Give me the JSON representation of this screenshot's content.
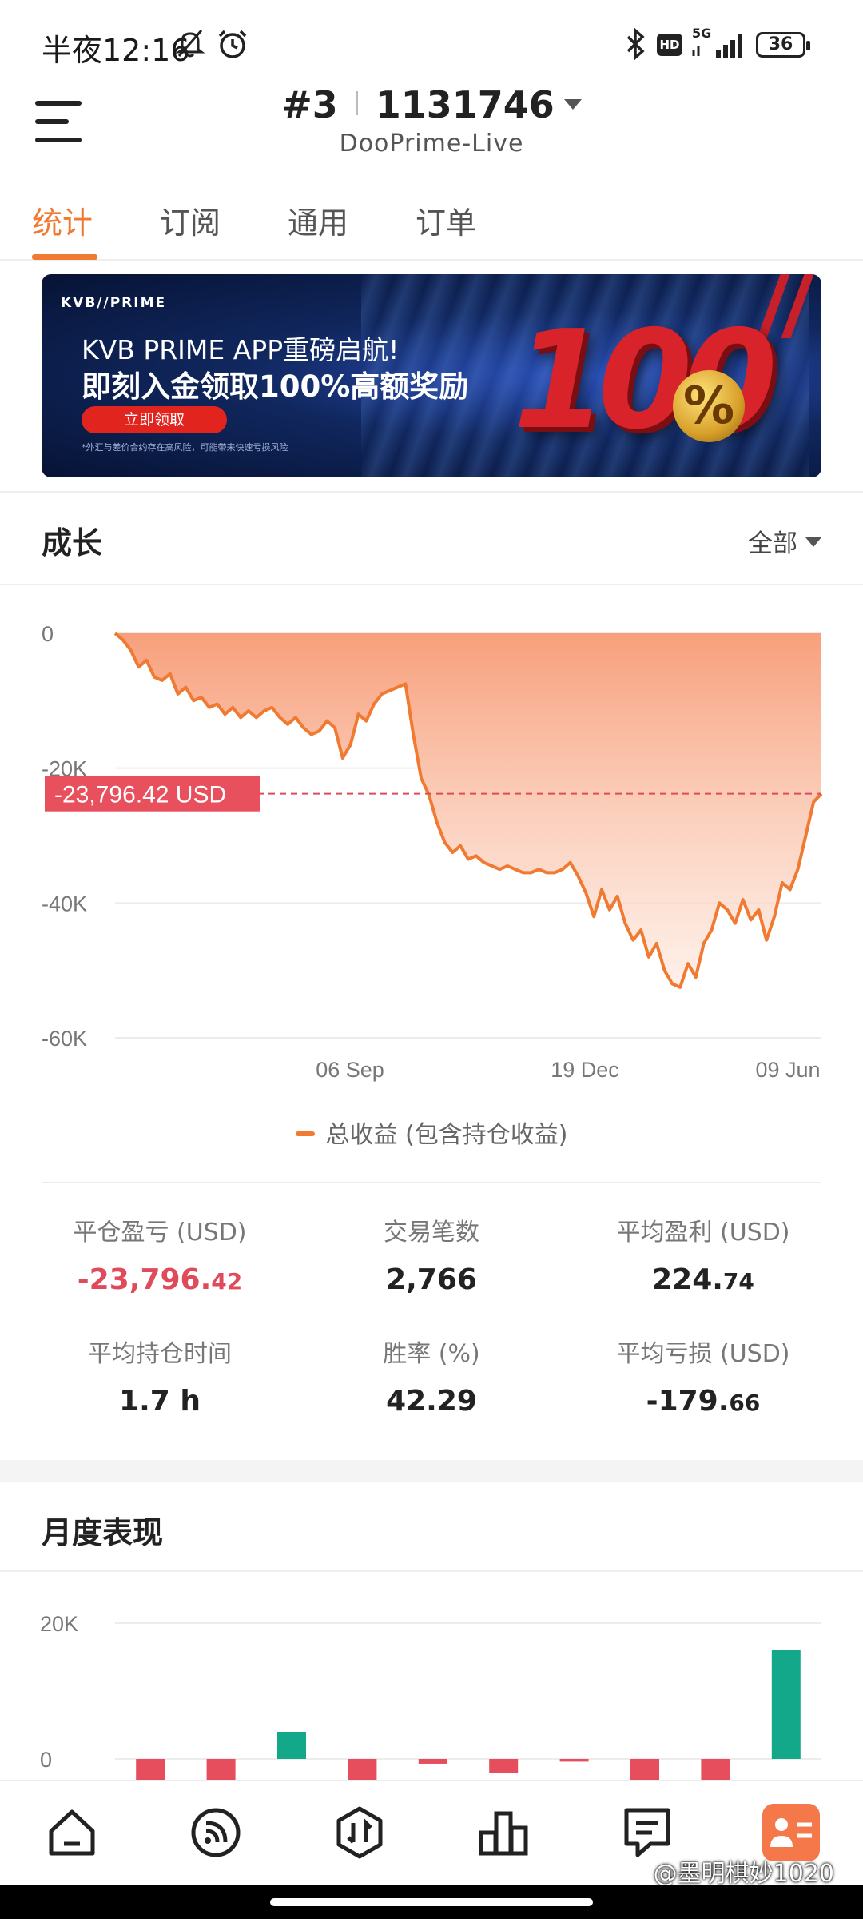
{
  "status_bar": {
    "time": "半夜12:16",
    "network": "5G",
    "hd": "HD",
    "battery": "36"
  },
  "header": {
    "account_prefix": "#3",
    "account_number": "1131746",
    "server": "DooPrime-Live"
  },
  "tabs": [
    {
      "label": "统计",
      "active": true
    },
    {
      "label": "订阅",
      "active": false
    },
    {
      "label": "通用",
      "active": false
    },
    {
      "label": "订单",
      "active": false
    }
  ],
  "banner": {
    "brand": "KVB//PRIME",
    "line1": "KVB PRIME APP重磅启航!",
    "line2": "即刻入金领取100%高额奖励",
    "cta": "立即领取",
    "fine_print": "*外汇与差价合约存在高风险，可能带来快速亏损风险",
    "big_number": "100",
    "percent": "%"
  },
  "growth": {
    "title": "成长",
    "filter": "全部",
    "current_label": "-23,796.42 USD",
    "legend": "总收益 (包含持仓收益)"
  },
  "chart_data": [
    {
      "type": "area",
      "title": "",
      "xlabel": "",
      "ylabel": "",
      "ylim": [
        -60000,
        0
      ],
      "y_ticks": [
        "0",
        "-20K",
        "-40K",
        "-60K"
      ],
      "x_ticks": [
        "06 Sep",
        "19 Dec",
        "09 Jun"
      ],
      "series": [
        {
          "name": "总收益 (包含持仓收益)",
          "color": "#f07a32",
          "values": [
            0,
            -1000,
            -2500,
            -5000,
            -4000,
            -6500,
            -7000,
            -6000,
            -9000,
            -8000,
            -10000,
            -9500,
            -11000,
            -10500,
            -12000,
            -11000,
            -12500,
            -11500,
            -12500,
            -11500,
            -11000,
            -12500,
            -13500,
            -12500,
            -14000,
            -15000,
            -14500,
            -13000,
            -14000,
            -18500,
            -16500,
            -12000,
            -13000,
            -10500,
            -9000,
            -8500,
            -8000,
            -7500,
            -15000,
            -21500,
            -24000,
            -28000,
            -31000,
            -32500,
            -31500,
            -33500,
            -33000,
            -34000,
            -34500,
            -35000,
            -34500,
            -35000,
            -35500,
            -35500,
            -35000,
            -35500,
            -35500,
            -35000,
            -34000,
            -36000,
            -38500,
            -42000,
            -38000,
            -41000,
            -39000,
            -43000,
            -45500,
            -44000,
            -48000,
            -46000,
            -50000,
            -52000,
            -52500,
            -49000,
            -51000,
            -46000,
            -44000,
            -40000,
            -41000,
            -43000,
            -39500,
            -42500,
            -41000,
            -45500,
            -42000,
            -37000,
            -38000,
            -35000,
            -30000,
            -25000,
            -23796.42
          ]
        }
      ],
      "current_value": -23796.42,
      "grid": true
    },
    {
      "type": "bar",
      "title": "月度表现",
      "y_ticks": [
        "20K",
        "0"
      ],
      "ylim": [
        -5000,
        25000
      ],
      "series": [
        {
          "name": "",
          "values": [
            -4000,
            -4000,
            4000,
            -4000,
            -700,
            -2000,
            -400,
            -4000,
            -4000,
            16000
          ]
        }
      ],
      "positive_color": "#13a88a",
      "negative_color": "#e64d5d"
    }
  ],
  "stats": [
    {
      "label": "平仓盈亏 (USD)",
      "main": "-23,796.",
      "dec": "42",
      "negative": true
    },
    {
      "label": "交易笔数",
      "main": "2,766",
      "dec": "",
      "negative": false
    },
    {
      "label": "平均盈利 (USD)",
      "main": "224.",
      "dec": "74",
      "negative": false
    },
    {
      "label": "平均持仓时间",
      "main": "1.7 h",
      "dec": "",
      "negative": false
    },
    {
      "label": "胜率 (%)",
      "main": "42.29",
      "dec": "",
      "negative": false
    },
    {
      "label": "平均亏损 (USD)",
      "main": "-179.",
      "dec": "66",
      "negative": false
    }
  ],
  "monthly": {
    "title": "月度表现"
  },
  "bottom_nav": [
    {
      "icon": "home-icon"
    },
    {
      "icon": "signal-icon"
    },
    {
      "icon": "trade-icon"
    },
    {
      "icon": "stats-icon"
    },
    {
      "icon": "news-icon"
    },
    {
      "icon": "profile-icon"
    }
  ],
  "watermark": "@墨明棋妙1020"
}
